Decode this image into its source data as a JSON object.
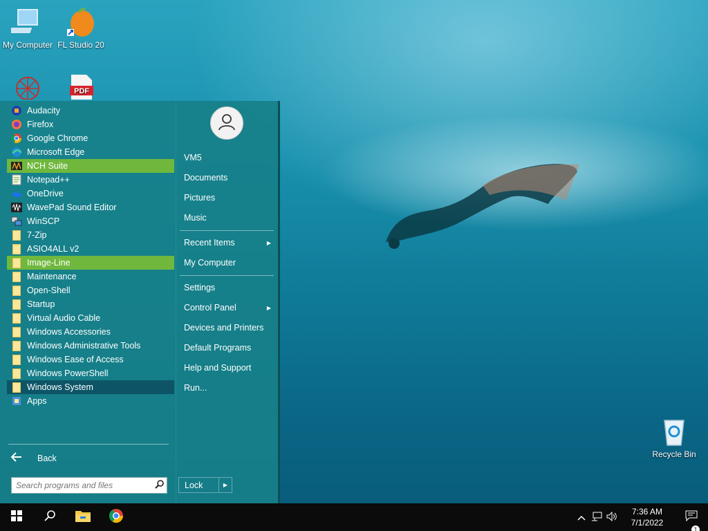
{
  "desktop": {
    "icons": [
      {
        "label": "My Computer"
      },
      {
        "label": "FL Studio 20"
      },
      {
        "label": ""
      },
      {
        "label": ""
      },
      {
        "label": "Recycle Bin"
      }
    ]
  },
  "start_menu": {
    "programs": [
      {
        "label": "Audacity",
        "icon": "audacity-icon",
        "state": "normal"
      },
      {
        "label": "Firefox",
        "icon": "firefox-icon",
        "state": "normal"
      },
      {
        "label": "Google Chrome",
        "icon": "chrome-icon",
        "state": "normal"
      },
      {
        "label": "Microsoft Edge",
        "icon": "edge-icon",
        "state": "normal"
      },
      {
        "label": "NCH Suite",
        "icon": "nch-icon",
        "state": "highlight"
      },
      {
        "label": "Notepad++",
        "icon": "notepadpp-icon",
        "state": "normal"
      },
      {
        "label": "OneDrive",
        "icon": "onedrive-icon",
        "state": "normal"
      },
      {
        "label": "WavePad Sound Editor",
        "icon": "wavepad-icon",
        "state": "normal"
      },
      {
        "label": "WinSCP",
        "icon": "winscp-icon",
        "state": "normal"
      },
      {
        "label": "7-Zip",
        "icon": "folder-icon",
        "state": "normal"
      },
      {
        "label": "ASIO4ALL v2",
        "icon": "folder-icon",
        "state": "normal"
      },
      {
        "label": "Image-Line",
        "icon": "folder-icon",
        "state": "highlight"
      },
      {
        "label": "Maintenance",
        "icon": "folder-icon",
        "state": "normal"
      },
      {
        "label": "Open-Shell",
        "icon": "folder-icon",
        "state": "normal"
      },
      {
        "label": "Startup",
        "icon": "folder-icon",
        "state": "normal"
      },
      {
        "label": "Virtual Audio Cable",
        "icon": "folder-icon",
        "state": "normal"
      },
      {
        "label": "Windows Accessories",
        "icon": "folder-icon",
        "state": "normal"
      },
      {
        "label": "Windows Administrative Tools",
        "icon": "folder-icon",
        "state": "normal"
      },
      {
        "label": "Windows Ease of Access",
        "icon": "folder-icon",
        "state": "normal"
      },
      {
        "label": "Windows PowerShell",
        "icon": "folder-icon",
        "state": "normal"
      },
      {
        "label": "Windows System",
        "icon": "folder-icon",
        "state": "selected"
      },
      {
        "label": "Apps",
        "icon": "apps-icon",
        "state": "normal"
      }
    ],
    "back_label": "Back",
    "search_placeholder": "Search programs and files",
    "right_items": [
      {
        "label": "VM5",
        "submenu": false
      },
      {
        "label": "Documents",
        "submenu": false
      },
      {
        "label": "Pictures",
        "submenu": false
      },
      {
        "label": "Music",
        "submenu": false
      },
      {
        "label": "Recent Items",
        "submenu": true
      },
      {
        "label": "My Computer",
        "submenu": false
      },
      {
        "label": "Settings",
        "submenu": false
      },
      {
        "label": "Control Panel",
        "submenu": true
      },
      {
        "label": "Devices and Printers",
        "submenu": false
      },
      {
        "label": "Default Programs",
        "submenu": false
      },
      {
        "label": "Help and Support",
        "submenu": false
      },
      {
        "label": "Run...",
        "submenu": false
      }
    ],
    "lock_label": "Lock"
  },
  "taskbar": {
    "time": "7:36 AM",
    "date": "7/1/2022",
    "notification_count": "1"
  },
  "colors": {
    "menu_bg": "#178089",
    "highlight": "#6fb83d",
    "selected": "#0d5566",
    "taskbar": "#0b0b0b"
  }
}
